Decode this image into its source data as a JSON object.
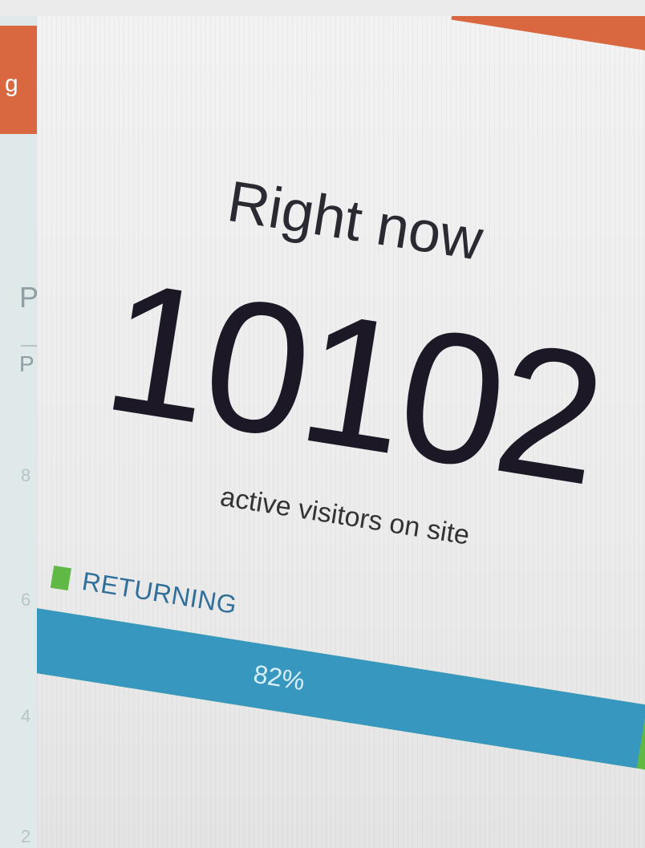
{
  "left_panel": {
    "header_fragment": "g",
    "text_fragment_1": "P",
    "text_fragment_2": "P",
    "ticks": [
      "8",
      "6",
      "4",
      "2"
    ]
  },
  "widget": {
    "title": "Right now",
    "active_count": "10102",
    "subtitle": "active visitors on site",
    "legend_label": "RETURNING",
    "returning_percent": 82,
    "returning_percent_label": "82%"
  },
  "colors": {
    "accent_orange": "#d9673f",
    "returning_green": "#5fb944",
    "bar_blue": "#3797bf",
    "legend_text_blue": "#2f6f9a"
  }
}
